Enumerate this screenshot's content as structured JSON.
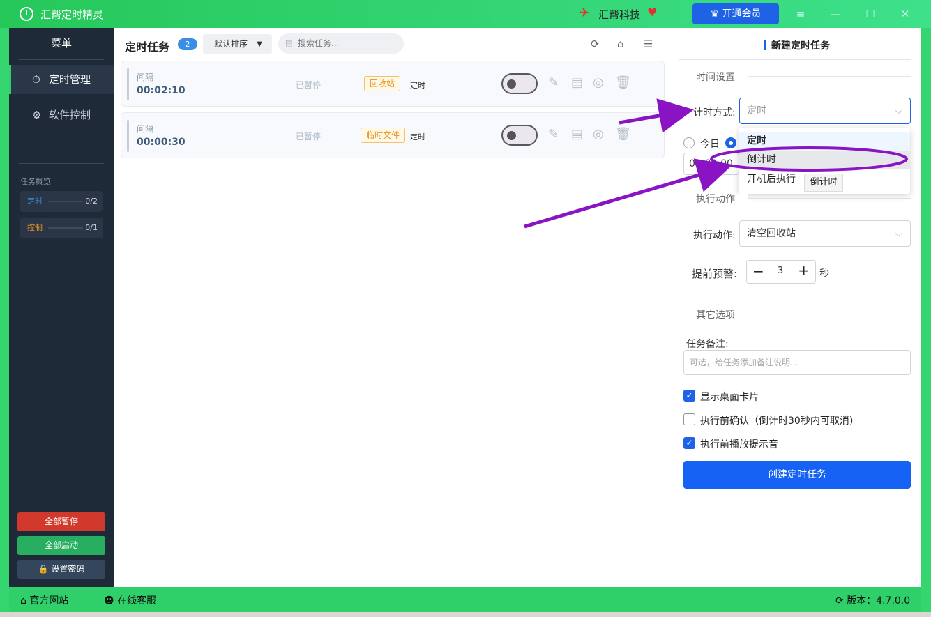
{
  "window": {
    "title": "汇帮定时精灵",
    "brand": "汇帮科技",
    "vip_button": "开通会员",
    "accent_color": "#2fd06a",
    "primary_color": "#1e63e6"
  },
  "sidebar": {
    "title": "菜单",
    "nav": [
      {
        "label": "定时管理",
        "icon": "clock-icon"
      },
      {
        "label": "软件控制",
        "icon": "gear-icon"
      }
    ],
    "overview_title": "任务概览",
    "overview": [
      {
        "label": "定时",
        "count": "0/2",
        "color": "#3a8ee6"
      },
      {
        "label": "控制",
        "count": "0/1",
        "color": "#e6912e"
      }
    ],
    "buttons": {
      "pause_all": "全部暂停",
      "start_all": "全部启动",
      "set_password": "设置密码"
    }
  },
  "tasks": {
    "title": "定时任务",
    "count": "2",
    "sort_label": "默认排序",
    "search_placeholder": "搜索任务...",
    "items": [
      {
        "mode": "间隔",
        "time": "00:02:10",
        "status": "已暂停",
        "tag": "回收站",
        "type": "定时"
      },
      {
        "mode": "间隔",
        "time": "00:00:30",
        "status": "已暂停",
        "tag": "临时文件",
        "type": "定时"
      }
    ]
  },
  "new_task": {
    "title": "新建定时任务",
    "section_time": "时间设置",
    "timing_label": "计时方式:",
    "timing_value": "定时",
    "radio_today": "今日",
    "time_value": "00:00:00",
    "dropdown_options": [
      "定时",
      "倒计时",
      "开机后执行"
    ],
    "tooltip": "倒计时",
    "section_action": "执行动作",
    "action_label": "执行动作:",
    "action_value": "清空回收站",
    "warn_label": "提前预警:",
    "warn_value": "3",
    "warn_unit": "秒",
    "section_other": "其它选项",
    "note_label": "任务备注:",
    "note_placeholder": "可选，给任务添加备注说明...",
    "checks": [
      {
        "label": "显示桌面卡片",
        "checked": true
      },
      {
        "label": "执行前确认（倒计时30秒内可取消)",
        "checked": false
      },
      {
        "label": "执行前播放提示音",
        "checked": true
      }
    ],
    "create_button": "创建定时任务"
  },
  "footer": {
    "website": "官方网站",
    "support": "在线客服",
    "version": "版本：4.7.0.0"
  }
}
